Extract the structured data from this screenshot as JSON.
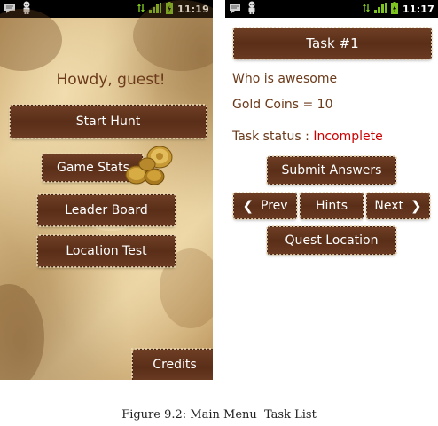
{
  "status_bar": {
    "left_time": "11:19",
    "right_time": "11:17"
  },
  "main_menu": {
    "greeting": "Howdy, guest!",
    "buttons": [
      {
        "label": "Start Hunt"
      },
      {
        "label": "Game Stats"
      },
      {
        "label": "Leader Board"
      },
      {
        "label": "Location Test"
      }
    ],
    "credits_label": "Credits"
  },
  "task_list": {
    "title": "Task #1",
    "question": "Who is awesome",
    "gold": "Gold Coins = 10",
    "status_label": "Task status : ",
    "status_value": "Incomplete",
    "submit_label": "Submit Answers",
    "prev_label": "Prev",
    "hints_label": "Hints",
    "next_label": "Next",
    "quest_location_label": "Quest Location",
    "status_color": "#cc0000"
  },
  "caption": "Figure 9.2: Main Menu  Task List",
  "colors": {
    "wood": "#5e3019",
    "text_brown": "#6b3a1a",
    "status_bar": "#000000",
    "battery_green": "#7ec421"
  }
}
